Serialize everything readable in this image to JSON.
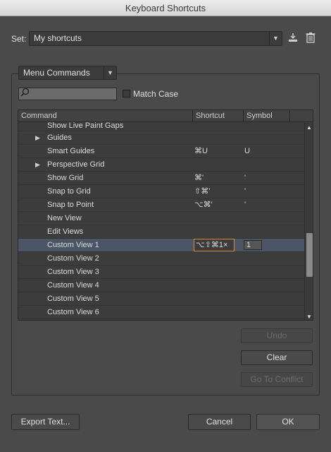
{
  "window": {
    "title": "Keyboard Shortcuts"
  },
  "set": {
    "label": "Set:",
    "value": "My shortcuts"
  },
  "icons": {
    "save_set": "save-set-icon",
    "delete_set": "trash-icon"
  },
  "category": {
    "value": "Menu Commands"
  },
  "search": {
    "placeholder": "",
    "value": ""
  },
  "match_case": {
    "label": "Match Case",
    "checked": false
  },
  "table": {
    "headers": {
      "command": "Command",
      "shortcut": "Shortcut",
      "symbol": "Symbol"
    },
    "rows": [
      {
        "command": "Show Live Paint Gaps",
        "shortcut": "",
        "symbol": "",
        "expandable": false,
        "partial": true
      },
      {
        "command": "Guides",
        "shortcut": "",
        "symbol": "",
        "expandable": true
      },
      {
        "command": "Smart Guides",
        "shortcut": "⌘U",
        "symbol": "U",
        "expandable": false
      },
      {
        "command": "Perspective Grid",
        "shortcut": "",
        "symbol": "",
        "expandable": true
      },
      {
        "command": "Show Grid",
        "shortcut": "⌘'",
        "symbol": "'",
        "expandable": false
      },
      {
        "command": "Snap to Grid",
        "shortcut": "⇧⌘'",
        "symbol": "'",
        "expandable": false
      },
      {
        "command": "Snap to Point",
        "shortcut": "⌥⌘'",
        "symbol": "'",
        "expandable": false
      },
      {
        "command": "New View",
        "shortcut": "",
        "symbol": "",
        "expandable": false
      },
      {
        "command": "Edit Views",
        "shortcut": "",
        "symbol": "",
        "expandable": false
      },
      {
        "command": "Custom View 1",
        "shortcut": "⌥⇧⌘1×",
        "symbol": "1",
        "expandable": false,
        "selected": true
      },
      {
        "command": "Custom View 2",
        "shortcut": "",
        "symbol": "",
        "expandable": false
      },
      {
        "command": "Custom View 3",
        "shortcut": "",
        "symbol": "",
        "expandable": false
      },
      {
        "command": "Custom View 4",
        "shortcut": "",
        "symbol": "",
        "expandable": false
      },
      {
        "command": "Custom View 5",
        "shortcut": "",
        "symbol": "",
        "expandable": false
      },
      {
        "command": "Custom View 6",
        "shortcut": "",
        "symbol": "",
        "expandable": false
      }
    ]
  },
  "side_buttons": {
    "undo": "Undo",
    "clear": "Clear",
    "go_to_conflict": "Go To Conflict"
  },
  "footer": {
    "export": "Export Text...",
    "cancel": "Cancel",
    "ok": "OK"
  }
}
